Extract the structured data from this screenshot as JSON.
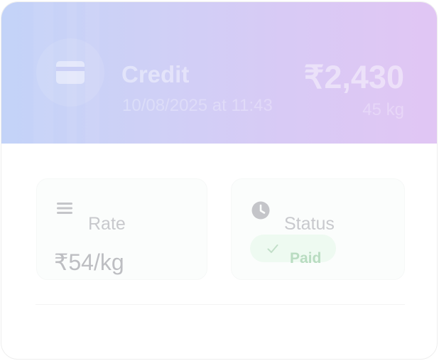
{
  "transaction": {
    "type_label": "Credit",
    "datetime": "10/08/2025 at 11:43",
    "amount": "₹2,430",
    "weight": "45 kg"
  },
  "details": {
    "rate_label": "Rate",
    "rate_value": "₹54/kg",
    "status_label": "Status",
    "status_value": "Paid"
  },
  "icons": {
    "header": "credit-card-icon",
    "rate": "menu-lines-icon",
    "status": "clock-icon",
    "badge": "check-icon"
  },
  "colors": {
    "header_gradient_start": "#c3d3f8",
    "header_gradient_end": "#e1c6f4",
    "paid_badge_bg": "#eefaf1",
    "paid_text": "#b9dcc1"
  }
}
